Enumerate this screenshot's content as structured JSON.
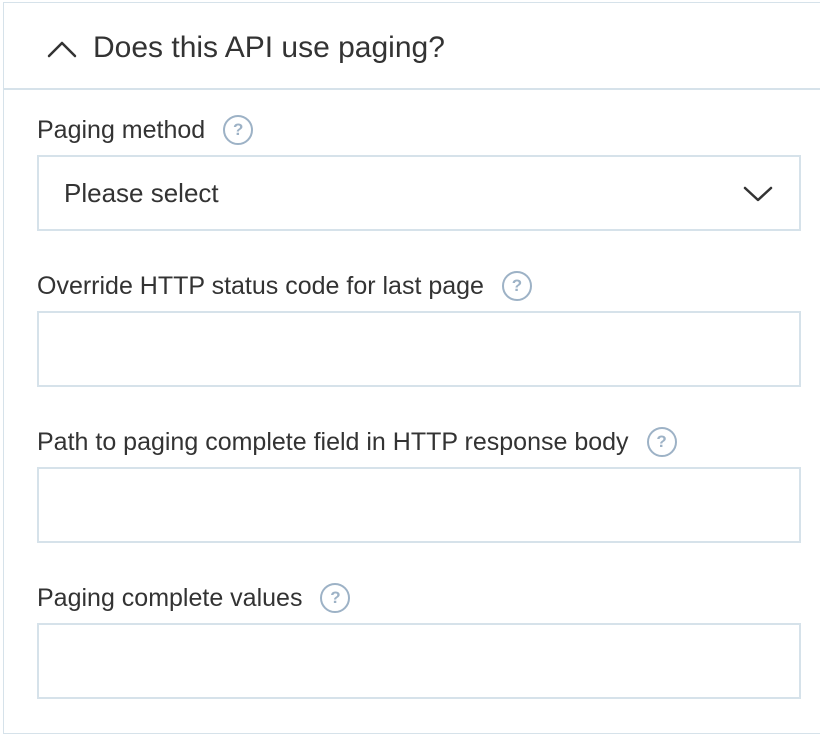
{
  "section": {
    "title": "Does this API use paging?",
    "toggle_icon": "chevron-up-icon"
  },
  "fields": {
    "paging_method": {
      "label": "Paging method",
      "selected_value": "Please select",
      "help_icon": "help-circle-icon"
    },
    "override_status_code": {
      "label": "Override HTTP status code for last page",
      "value": "",
      "placeholder": "",
      "help_icon": "help-circle-icon"
    },
    "paging_complete_path": {
      "label": "Path to paging complete field in HTTP response body",
      "value": "",
      "placeholder": "",
      "help_icon": "help-circle-icon"
    },
    "paging_complete_values": {
      "label": "Paging complete values",
      "value": "",
      "placeholder": "",
      "help_icon": "help-circle-icon"
    }
  },
  "help_glyph": "?",
  "colors": {
    "border": "#d6e2ea",
    "help_icon": "#9db2c6",
    "text": "#333333"
  }
}
